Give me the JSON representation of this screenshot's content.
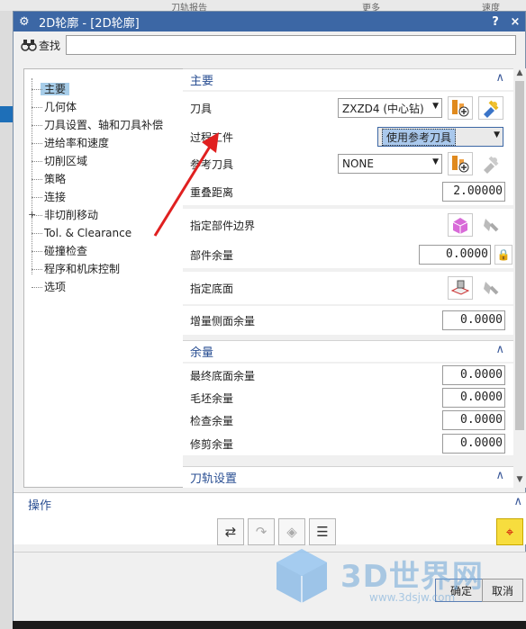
{
  "background": {
    "top_labels": [
      "刀轨报告",
      "更多",
      "速度"
    ]
  },
  "dialog": {
    "title": "2D轮廓 - [2D轮廓]",
    "help_label": "?",
    "close_label": "×",
    "find_label": "查找",
    "find_value": ""
  },
  "nav": {
    "items": [
      {
        "label": "主要",
        "selected": true
      },
      {
        "label": "几何体"
      },
      {
        "label": "刀具设置、轴和刀具补偿"
      },
      {
        "label": "进给率和速度"
      },
      {
        "label": "切削区域"
      },
      {
        "label": "策略"
      },
      {
        "label": "连接"
      },
      {
        "label": "非切削移动",
        "expandable": true
      },
      {
        "label": "Tol. & Clearance"
      },
      {
        "label": "碰撞检查"
      },
      {
        "label": "程序和机床控制"
      },
      {
        "label": "选项"
      }
    ]
  },
  "main_section": {
    "title": "主要",
    "tool_label": "刀具",
    "tool_value": "ZXZD4 (中心钻)",
    "process_label": "过程工件",
    "process_value": "使用参考刀具",
    "ref_tool_label": "参考刀具",
    "ref_tool_value": "NONE",
    "overlap_label": "重叠距离",
    "overlap_value": "2.00000",
    "part_boundary_label": "指定部件边界",
    "part_stock_label": "部件余量",
    "part_stock_value": "0.0000",
    "floor_label": "指定底面",
    "side_stock_label": "增量侧面余量",
    "side_stock_value": "0.0000"
  },
  "stock_section": {
    "title": "余量",
    "final_floor_label": "最终底面余量",
    "final_floor_value": "0.0000",
    "blank_label": "毛坯余量",
    "blank_value": "0.0000",
    "check_label": "检查余量",
    "check_value": "0.0000",
    "trim_label": "修剪余量",
    "trim_value": "0.0000"
  },
  "path_section": {
    "title": "刀轨设置"
  },
  "operations": {
    "title": "操作"
  },
  "footer": {
    "ok_label": "确定",
    "cancel_label": "取消"
  },
  "watermark": {
    "text": "3D世界网",
    "url": "www.3dsjw.com"
  },
  "icons": {
    "gear": "gear-icon",
    "find": "binoculars-icon",
    "collapse": "caret-up-icon"
  },
  "colors": {
    "titlebar": "#3c67a5",
    "section_title": "#2a4f93",
    "selection": "#a7cde9",
    "annotation_arrow": "#e02020"
  }
}
